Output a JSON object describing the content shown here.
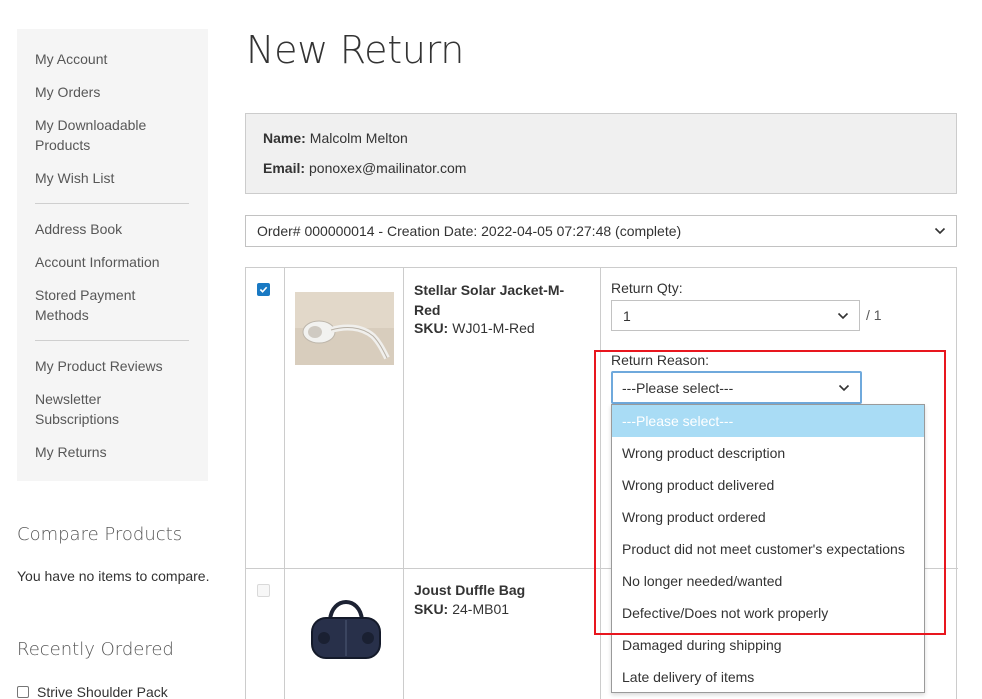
{
  "sidebar": {
    "items": [
      {
        "label": "My Account"
      },
      {
        "label": "My Orders"
      },
      {
        "label": "My Downloadable Products"
      },
      {
        "label": "My Wish List"
      },
      {
        "label": "Address Book"
      },
      {
        "label": "Account Information"
      },
      {
        "label": "Stored Payment Methods"
      },
      {
        "label": "My Product Reviews"
      },
      {
        "label": "Newsletter Subscriptions"
      },
      {
        "label": "My Returns"
      }
    ],
    "compare": {
      "title": "Compare Products",
      "empty_text": "You have no items to compare."
    },
    "recent": {
      "title": "Recently Ordered",
      "items": [
        "Strive Shoulder Pack"
      ]
    }
  },
  "page": {
    "title": "New Return"
  },
  "customer": {
    "name_label": "Name:",
    "name": "Malcolm Melton",
    "email_label": "Email:",
    "email": "ponoxex@mailinator.com"
  },
  "order_select": {
    "value": "Order# 000000014 - Creation Date: 2022-04-05 07:27:48 (complete)"
  },
  "items": [
    {
      "checked": true,
      "name": "Stellar Solar Jacket-M-Red",
      "sku_label": "SKU:",
      "sku": "WJ01-M-Red",
      "qty_label": "Return Qty:",
      "qty_value": "1",
      "qty_of": "/ 1",
      "reason_label": "Return Reason:",
      "reason_value": "---Please select---"
    },
    {
      "checked": false,
      "name": "Joust Duffle Bag",
      "sku_label": "SKU:",
      "sku": "24-MB01"
    }
  ],
  "reason_options": [
    "---Please select---",
    "Wrong product description",
    "Wrong product delivered",
    "Wrong product ordered",
    "Product did not meet customer's expectations",
    "No longer needed/wanted",
    "Defective/Does not work properly",
    "Damaged during shipping",
    "Late delivery of items"
  ],
  "colors": {
    "accent": "#1979c3",
    "highlight": "#e8161e",
    "option_selected": "#a9dcf5"
  }
}
